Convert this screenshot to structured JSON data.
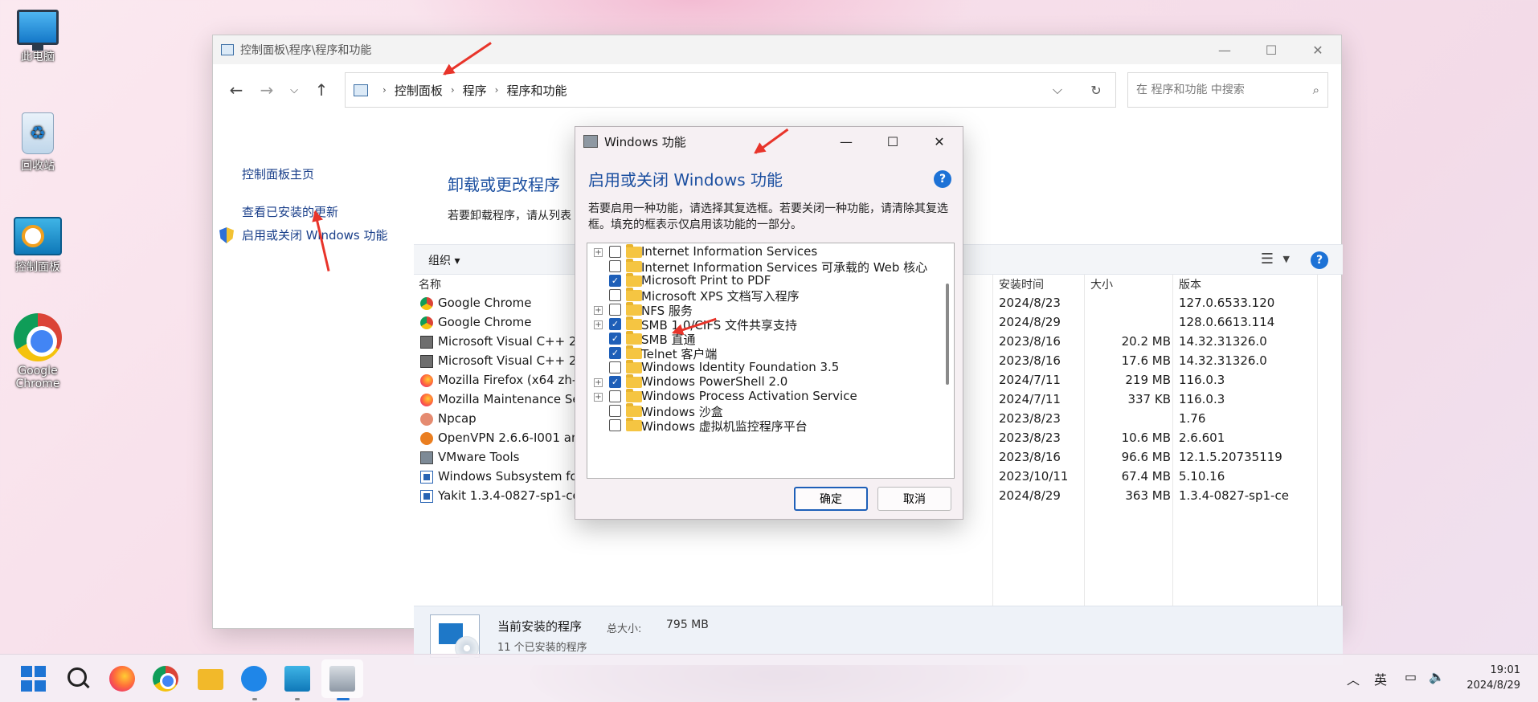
{
  "desktop": {
    "icons": [
      {
        "label": "此电脑"
      },
      {
        "label": "回收站"
      },
      {
        "label": "控制面板"
      },
      {
        "label": "Google Chrome"
      }
    ]
  },
  "window": {
    "title": "控制面板\\程序\\程序和功能",
    "breadcrumb": [
      "控制面板",
      "程序",
      "程序和功能"
    ],
    "search_placeholder": "在 程序和功能 中搜索",
    "left_links": [
      "控制面板主页",
      "查看已安装的更新",
      "启用或关闭 Windows 功能"
    ],
    "heading": "卸载或更改程序",
    "description": "若要卸载程序，请从列表",
    "toolbar": {
      "organize": "组织 ▾"
    },
    "columns": {
      "name": "名称",
      "date": "安装时间",
      "size": "大小",
      "version": "版本"
    },
    "programs": [
      {
        "name": "Google Chrome",
        "date": "2024/8/23",
        "size": "",
        "version": "127.0.6533.120",
        "icon": "chrome-icon"
      },
      {
        "name": "Google Chrome",
        "date": "2024/8/29",
        "size": "",
        "version": "128.0.6613.114",
        "icon": "chrome-icon"
      },
      {
        "name": "Microsoft Visual C++ 20",
        "date": "2023/8/16",
        "size": "20.2 MB",
        "version": "14.32.31326.0",
        "icon": "installer-icon"
      },
      {
        "name": "Microsoft Visual C++ 20",
        "date": "2023/8/16",
        "size": "17.6 MB",
        "version": "14.32.31326.0",
        "icon": "installer-icon"
      },
      {
        "name": "Mozilla Firefox (x64 zh-C",
        "date": "2024/7/11",
        "size": "219 MB",
        "version": "116.0.3",
        "icon": "firefox-icon"
      },
      {
        "name": "Mozilla Maintenance Se",
        "date": "2024/7/11",
        "size": "337 KB",
        "version": "116.0.3",
        "icon": "firefox-icon"
      },
      {
        "name": "Npcap",
        "date": "2023/8/23",
        "size": "",
        "version": "1.76",
        "icon": "npcap-icon"
      },
      {
        "name": "OpenVPN 2.6.6-I001 am",
        "date": "2023/8/23",
        "size": "10.6 MB",
        "version": "2.6.601",
        "icon": "openvpn-icon"
      },
      {
        "name": "VMware Tools",
        "date": "2023/8/16",
        "size": "96.6 MB",
        "version": "12.1.5.20735119",
        "icon": "vmware-icon"
      },
      {
        "name": "Windows Subsystem for",
        "date": "2023/10/11",
        "size": "67.4 MB",
        "version": "5.10.16",
        "icon": "wsl-icon"
      },
      {
        "name": "Yakit 1.3.4-0827-sp1-ce",
        "date": "2024/8/29",
        "size": "363 MB",
        "version": "1.3.4-0827-sp1-ce",
        "icon": "yakit-icon"
      }
    ],
    "status": {
      "title": "当前安装的程序",
      "total_label": "总大小:",
      "total_value": "795 MB",
      "count": "11 个已安装的程序"
    }
  },
  "dialog": {
    "title": "Windows 功能",
    "heading": "启用或关闭 Windows 功能",
    "info": "若要启用一种功能，请选择其复选框。若要关闭一种功能，请清除其复选框。填充的框表示仅启用该功能的一部分。",
    "features": [
      {
        "label": "Internet Information Services",
        "expandable": true,
        "checked": false
      },
      {
        "label": "Internet Information Services 可承载的 Web 核心",
        "expandable": false,
        "checked": false
      },
      {
        "label": "Microsoft Print to PDF",
        "expandable": false,
        "checked": true
      },
      {
        "label": "Microsoft XPS 文档写入程序",
        "expandable": false,
        "checked": false
      },
      {
        "label": "NFS 服务",
        "expandable": true,
        "checked": false
      },
      {
        "label": "SMB 1.0/CIFS 文件共享支持",
        "expandable": true,
        "checked": true
      },
      {
        "label": "SMB 直通",
        "expandable": false,
        "checked": true
      },
      {
        "label": "Telnet 客户端",
        "expandable": false,
        "checked": true
      },
      {
        "label": "Windows Identity Foundation 3.5",
        "expandable": false,
        "checked": false
      },
      {
        "label": "Windows PowerShell 2.0",
        "expandable": true,
        "checked": true
      },
      {
        "label": "Windows Process Activation Service",
        "expandable": true,
        "checked": false
      },
      {
        "label": "Windows 沙盒",
        "expandable": false,
        "checked": false
      },
      {
        "label": "Windows 虚拟机监控程序平台",
        "expandable": false,
        "checked": false
      }
    ],
    "ok_label": "确定",
    "cancel_label": "取消"
  },
  "taskbar": {
    "tray_lang": "英",
    "time": "19:01",
    "date": "2024/8/29"
  },
  "colors": {
    "accent": "#1e5fb8",
    "link": "#1a3f8a",
    "annotation_arrow": "#e8342a"
  }
}
